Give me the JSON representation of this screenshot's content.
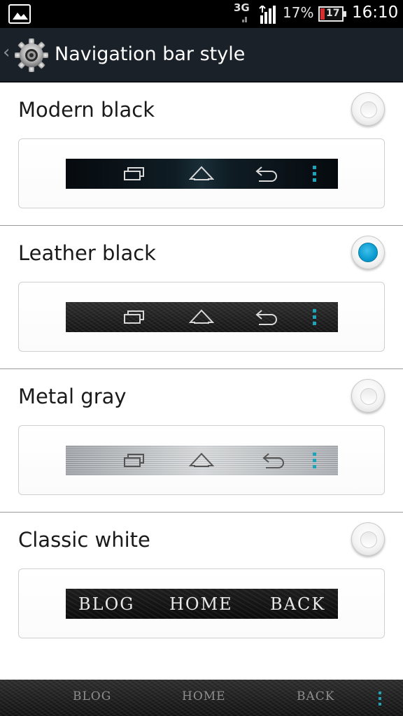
{
  "status_bar": {
    "network": "3G",
    "battery_percent": "17%",
    "battery_level": "17",
    "time": "16:10",
    "icons": [
      "gallery-icon",
      "signal-icon",
      "battery-icon"
    ]
  },
  "action_bar": {
    "title": "Navigation bar style",
    "icons": [
      "back-chevron-icon",
      "settings-gear-icon"
    ]
  },
  "options": [
    {
      "title": "Modern black",
      "selected": false,
      "style": "modern"
    },
    {
      "title": "Leather black",
      "selected": true,
      "style": "leather"
    },
    {
      "title": "Metal gray",
      "selected": false,
      "style": "metal"
    },
    {
      "title": "Classic white",
      "selected": false,
      "style": "classic",
      "preview_labels": {
        "blog": "BLOG",
        "home": "HOME",
        "back": "BACK"
      }
    }
  ],
  "system_nav": {
    "blog": "BLOG",
    "home": "HOME",
    "back": "BACK"
  },
  "colors": {
    "accent": "#0a9bd0",
    "action_bar_bg": "#1b2128",
    "menu_dots": "#1fa3b8"
  }
}
